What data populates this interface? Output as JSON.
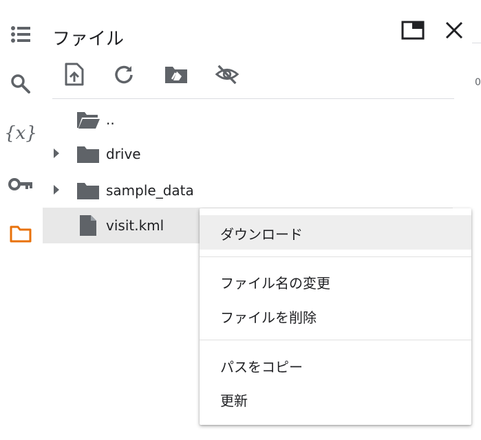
{
  "sidebar": {
    "items": [
      {
        "icon": "toc-icon"
      },
      {
        "icon": "search-icon"
      },
      {
        "icon": "variables-icon",
        "glyph": "{x}"
      },
      {
        "icon": "key-icon"
      },
      {
        "icon": "folder-icon",
        "active": true
      }
    ],
    "active_color": "#e8710a"
  },
  "panel": {
    "title": "ファイル",
    "toolbar": [
      "upload-icon",
      "refresh-icon",
      "drive-icon",
      "hide-icon"
    ]
  },
  "files": [
    {
      "name": "..",
      "type": "parent-folder"
    },
    {
      "name": "drive",
      "type": "folder",
      "expandable": true
    },
    {
      "name": "sample_data",
      "type": "folder",
      "expandable": true
    },
    {
      "name": "visit.kml",
      "type": "file",
      "selected": true
    }
  ],
  "context_menu": {
    "groups": [
      [
        "ダウンロード"
      ],
      [
        "ファイル名の変更",
        "ファイルを削除"
      ],
      [
        "パスをコピー",
        "更新"
      ]
    ]
  },
  "edge_text": "0",
  "colors": {
    "icon_gray": "#5f6368",
    "hover_bg": "#eeeeee",
    "selected_bg": "#e8e8e8"
  }
}
